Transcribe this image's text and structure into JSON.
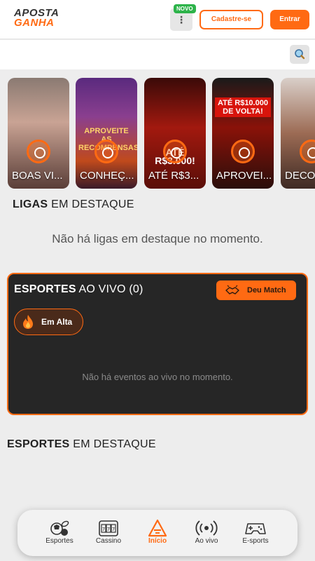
{
  "header": {
    "logo_line1": "APOSTA",
    "logo_line2": "GANHA",
    "novo_badge": "NOVO",
    "menu_dots": "⋮",
    "signup_label": "Cadastre-se",
    "login_label": "Entrar"
  },
  "search": {
    "icon": "search-icon"
  },
  "stories": [
    {
      "title": "BOAS VI...",
      "headline": ""
    },
    {
      "title": "CONHEÇ...",
      "headline": "APROVEITE AS RECOMPENSAS"
    },
    {
      "title": "ATÉ R$3...",
      "headline": "ATÉ R$3.000!"
    },
    {
      "title": "APROVEI...",
      "headline": "ATÉ R$10.000 DE VOLTA!"
    },
    {
      "title": "DECO...",
      "headline": ""
    }
  ],
  "leagues": {
    "title_bold": "LIGAS",
    "title_rest": " EM DESTAQUE",
    "empty_text": "Não há ligas em destaque no momento."
  },
  "live": {
    "title_bold": "ESPORTES",
    "title_rest": " AO VIVO (0)",
    "match_button": "Deu Match",
    "trend_chip": "Em Alta",
    "empty_text": "Não há eventos ao vivo no momento."
  },
  "featured": {
    "title_bold": "ESPORTES",
    "title_rest": " EM DESTAQUE"
  },
  "colors": {
    "accent": "#ff6a13",
    "dark_panel": "#262626",
    "badge_green": "#2db34a"
  },
  "bottom_nav": [
    {
      "label": "Esportes",
      "icon": "sports-balls-icon",
      "active": false
    },
    {
      "label": "Cassino",
      "icon": "slot-machine-icon",
      "active": false
    },
    {
      "label": "Início",
      "icon": "home-logo-icon",
      "active": true
    },
    {
      "label": "Ao vivo",
      "icon": "live-broadcast-icon",
      "active": false
    },
    {
      "label": "E-sports",
      "icon": "gamepad-icon",
      "active": false
    }
  ]
}
